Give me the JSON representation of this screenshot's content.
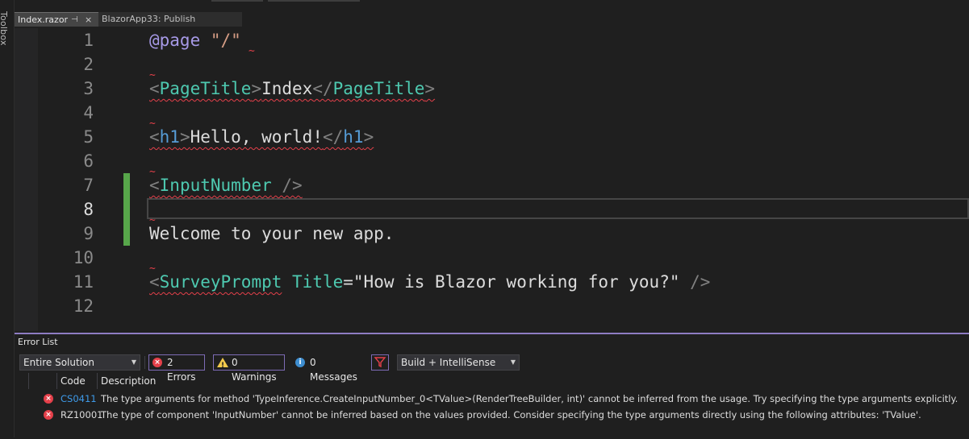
{
  "toolbox": {
    "label": "Toolbox"
  },
  "tabs": [
    {
      "label": "Index.razor",
      "pin": "⊣",
      "close": "×"
    },
    {
      "label": "BlazorApp33: Publish"
    }
  ],
  "editor": {
    "current_line": 8,
    "lines": [
      {
        "n": "1"
      },
      {
        "n": "2"
      },
      {
        "n": "3"
      },
      {
        "n": "4"
      },
      {
        "n": "5"
      },
      {
        "n": "6"
      },
      {
        "n": "7"
      },
      {
        "n": "8"
      },
      {
        "n": "9"
      },
      {
        "n": "10"
      },
      {
        "n": "11"
      },
      {
        "n": "12"
      }
    ],
    "code": {
      "l1_directive": "@page",
      "l1_string": "\"/\"",
      "l3_open": "<",
      "l3_tag": "PageTitle",
      "l3_gt": ">",
      "l3_text": "Index",
      "l3_close_open": "</",
      "l3_close_tag": "PageTitle",
      "l3_close_gt": ">",
      "l5_open": "<",
      "l5_tag": "h1",
      "l5_gt": ">",
      "l5_text": "Hello, world!",
      "l5_close_open": "</",
      "l5_close_tag": "h1",
      "l5_close_gt": ">",
      "l7_open": "<",
      "l7_tag": "InputNumber",
      "l7_selfclose": " />",
      "l9_text": "Welcome to your new app.",
      "l11_open": "<",
      "l11_tag": "SurveyPrompt",
      "l11_attr": "Title",
      "l11_eq": "=",
      "l11_value": "\"How is Blazor working for you?\"",
      "l11_selfclose": " />"
    }
  },
  "error_list": {
    "title": "Error List",
    "scope_dropdown": "Entire Solution",
    "errors_button": "2 Errors",
    "warnings_button": "0 Warnings",
    "messages_button": "0 Messages",
    "build_dropdown": "Build + IntelliSense",
    "columns": {
      "code": "Code",
      "description": "Description"
    },
    "rows": [
      {
        "code": "CS0411",
        "description": "The type arguments for method 'TypeInference.CreateInputNumber_0<TValue>(RenderTreeBuilder, int)' cannot be inferred from the usage. Try specifying the type arguments explicitly."
      },
      {
        "code": "RZ10001",
        "description": "The type of component 'InputNumber' cannot be inferred based on the values provided. Consider specifying the type arguments directly using the following attributes: 'TValue'."
      }
    ]
  }
}
